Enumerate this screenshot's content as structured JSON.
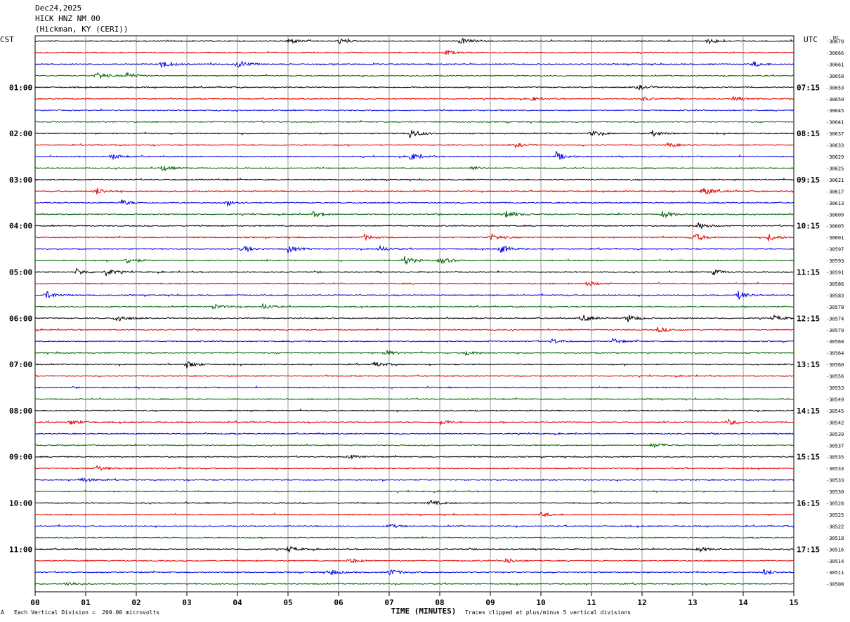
{
  "header": {
    "date": "Dec24,2025",
    "station": "HICK HNZ NM 00",
    "location": "(Hickman, KY (CERI))"
  },
  "left_zone": "CST",
  "right_zone": "UTC",
  "dc_label": "DC",
  "footer": {
    "scale": "Each Vertical Division =  200.00 microvolts",
    "clip": "Traces clipped at plus/minus 5 vertical divisions",
    "mark": "A"
  },
  "colors": {
    "trace1": "#000000",
    "trace2": "#e00000",
    "trace3": "#0000e0",
    "trace4": "#006400",
    "grid": "#808080"
  },
  "chart_data": {
    "type": "line",
    "title": "HICK HNZ NM 00",
    "xlabel": "TIME (MINUTES)",
    "x_ticks": [
      "00",
      "01",
      "02",
      "03",
      "04",
      "05",
      "06",
      "07",
      "08",
      "09",
      "10",
      "11",
      "12",
      "13",
      "14",
      "15"
    ],
    "xlim": [
      0,
      15
    ],
    "rows": 48,
    "left_labels": [
      "01:00",
      "02:00",
      "03:00",
      "04:00",
      "05:00",
      "06:00",
      "07:00",
      "08:00",
      "09:00",
      "10:00",
      "11:00"
    ],
    "right_labels": [
      "07:15",
      "08:15",
      "09:15",
      "10:15",
      "11:15",
      "12:15",
      "13:15",
      "14:15",
      "15:15",
      "16:15",
      "17:15"
    ],
    "dc_offsets": [
      "-30670",
      "-30666",
      "-30661",
      "-30658",
      "-30653",
      "-30650",
      "-30645",
      "-30641",
      "-30637",
      "-30633",
      "-30629",
      "-30625",
      "-30621",
      "-30617",
      "-30613",
      "-30609",
      "-30605",
      "-30601",
      "-30597",
      "-30593",
      "-30591",
      "-30586",
      "-30583",
      "-30578",
      "-30574",
      "-30570",
      "-30568",
      "-30564",
      "-30560",
      "-30556",
      "-30553",
      "-30549",
      "-30545",
      "-30542",
      "-30539",
      "-30537",
      "-30535",
      "-30533",
      "-30533",
      "-30530",
      "-30528",
      "-30525",
      "-30522",
      "-30518",
      "-30516",
      "-30514",
      "-30511",
      "-30508"
    ],
    "trace_colors": [
      "#000000",
      "#e00000",
      "#0000e0",
      "#006400"
    ],
    "events": [
      {
        "row": 0,
        "minute": 5.0,
        "amp": 4
      },
      {
        "row": 0,
        "minute": 6.0,
        "amp": 4
      },
      {
        "row": 0,
        "minute": 8.4,
        "amp": 5
      },
      {
        "row": 0,
        "minute": 13.3,
        "amp": 4
      },
      {
        "row": 1,
        "minute": 8.1,
        "amp": 4
      },
      {
        "row": 2,
        "minute": 2.5,
        "amp": 6
      },
      {
        "row": 2,
        "minute": 4.0,
        "amp": 6
      },
      {
        "row": 2,
        "minute": 14.2,
        "amp": 4
      },
      {
        "row": 3,
        "minute": 1.2,
        "amp": 6
      },
      {
        "row": 3,
        "minute": 1.8,
        "amp": 5
      },
      {
        "row": 4,
        "minute": 11.9,
        "amp": 4
      },
      {
        "row": 5,
        "minute": 9.8,
        "amp": 3
      },
      {
        "row": 5,
        "minute": 12.0,
        "amp": 3
      },
      {
        "row": 5,
        "minute": 13.8,
        "amp": 3
      },
      {
        "row": 8,
        "minute": 7.4,
        "amp": 7
      },
      {
        "row": 8,
        "minute": 11.0,
        "amp": 4
      },
      {
        "row": 8,
        "minute": 12.2,
        "amp": 4
      },
      {
        "row": 9,
        "minute": 9.5,
        "amp": 3
      },
      {
        "row": 9,
        "minute": 12.5,
        "amp": 3
      },
      {
        "row": 10,
        "minute": 1.5,
        "amp": 4
      },
      {
        "row": 10,
        "minute": 7.4,
        "amp": 6
      },
      {
        "row": 10,
        "minute": 10.3,
        "amp": 6
      },
      {
        "row": 11,
        "minute": 2.5,
        "amp": 4
      },
      {
        "row": 11,
        "minute": 8.6,
        "amp": 3
      },
      {
        "row": 13,
        "minute": 1.2,
        "amp": 5
      },
      {
        "row": 13,
        "minute": 13.2,
        "amp": 7
      },
      {
        "row": 14,
        "minute": 1.7,
        "amp": 4
      },
      {
        "row": 14,
        "minute": 3.8,
        "amp": 4
      },
      {
        "row": 15,
        "minute": 5.5,
        "amp": 4
      },
      {
        "row": 15,
        "minute": 9.3,
        "amp": 6
      },
      {
        "row": 15,
        "minute": 12.4,
        "amp": 5
      },
      {
        "row": 16,
        "minute": 13.1,
        "amp": 5
      },
      {
        "row": 17,
        "minute": 6.5,
        "amp": 4
      },
      {
        "row": 17,
        "minute": 9.0,
        "amp": 5
      },
      {
        "row": 17,
        "minute": 13.0,
        "amp": 7
      },
      {
        "row": 17,
        "minute": 14.5,
        "amp": 5
      },
      {
        "row": 18,
        "minute": 4.1,
        "amp": 5
      },
      {
        "row": 18,
        "minute": 5.0,
        "amp": 5
      },
      {
        "row": 18,
        "minute": 6.8,
        "amp": 4
      },
      {
        "row": 18,
        "minute": 9.2,
        "amp": 6
      },
      {
        "row": 19,
        "minute": 1.8,
        "amp": 5
      },
      {
        "row": 19,
        "minute": 7.3,
        "amp": 6
      },
      {
        "row": 19,
        "minute": 8.0,
        "amp": 5
      },
      {
        "row": 20,
        "minute": 0.8,
        "amp": 5
      },
      {
        "row": 20,
        "minute": 1.4,
        "amp": 5
      },
      {
        "row": 20,
        "minute": 13.4,
        "amp": 4
      },
      {
        "row": 21,
        "minute": 10.9,
        "amp": 4
      },
      {
        "row": 22,
        "minute": 0.2,
        "amp": 6
      },
      {
        "row": 22,
        "minute": 13.9,
        "amp": 6
      },
      {
        "row": 23,
        "minute": 3.5,
        "amp": 4
      },
      {
        "row": 23,
        "minute": 4.5,
        "amp": 4
      },
      {
        "row": 24,
        "minute": 1.6,
        "amp": 6
      },
      {
        "row": 24,
        "minute": 10.8,
        "amp": 5
      },
      {
        "row": 24,
        "minute": 11.7,
        "amp": 6
      },
      {
        "row": 24,
        "minute": 14.6,
        "amp": 4
      },
      {
        "row": 25,
        "minute": 12.3,
        "amp": 4
      },
      {
        "row": 26,
        "minute": 10.2,
        "amp": 4
      },
      {
        "row": 26,
        "minute": 11.4,
        "amp": 4
      },
      {
        "row": 27,
        "minute": 6.9,
        "amp": 4
      },
      {
        "row": 27,
        "minute": 8.5,
        "amp": 4
      },
      {
        "row": 28,
        "minute": 3.0,
        "amp": 5
      },
      {
        "row": 28,
        "minute": 6.7,
        "amp": 4
      },
      {
        "row": 33,
        "minute": 0.7,
        "amp": 4
      },
      {
        "row": 33,
        "minute": 8.0,
        "amp": 4
      },
      {
        "row": 33,
        "minute": 13.7,
        "amp": 4
      },
      {
        "row": 35,
        "minute": 12.2,
        "amp": 4
      },
      {
        "row": 36,
        "minute": 6.2,
        "amp": 3
      },
      {
        "row": 37,
        "minute": 1.2,
        "amp": 4
      },
      {
        "row": 38,
        "minute": 0.9,
        "amp": 4
      },
      {
        "row": 40,
        "minute": 7.8,
        "amp": 4
      },
      {
        "row": 41,
        "minute": 10.0,
        "amp": 3
      },
      {
        "row": 42,
        "minute": 7.0,
        "amp": 3
      },
      {
        "row": 44,
        "minute": 5.0,
        "amp": 4
      },
      {
        "row": 44,
        "minute": 13.1,
        "amp": 4
      },
      {
        "row": 45,
        "minute": 6.2,
        "amp": 4
      },
      {
        "row": 45,
        "minute": 9.3,
        "amp": 4
      },
      {
        "row": 46,
        "minute": 5.8,
        "amp": 4
      },
      {
        "row": 46,
        "minute": 7.0,
        "amp": 5
      },
      {
        "row": 46,
        "minute": 14.4,
        "amp": 4
      },
      {
        "row": 47,
        "minute": 0.6,
        "amp": 4
      }
    ]
  }
}
